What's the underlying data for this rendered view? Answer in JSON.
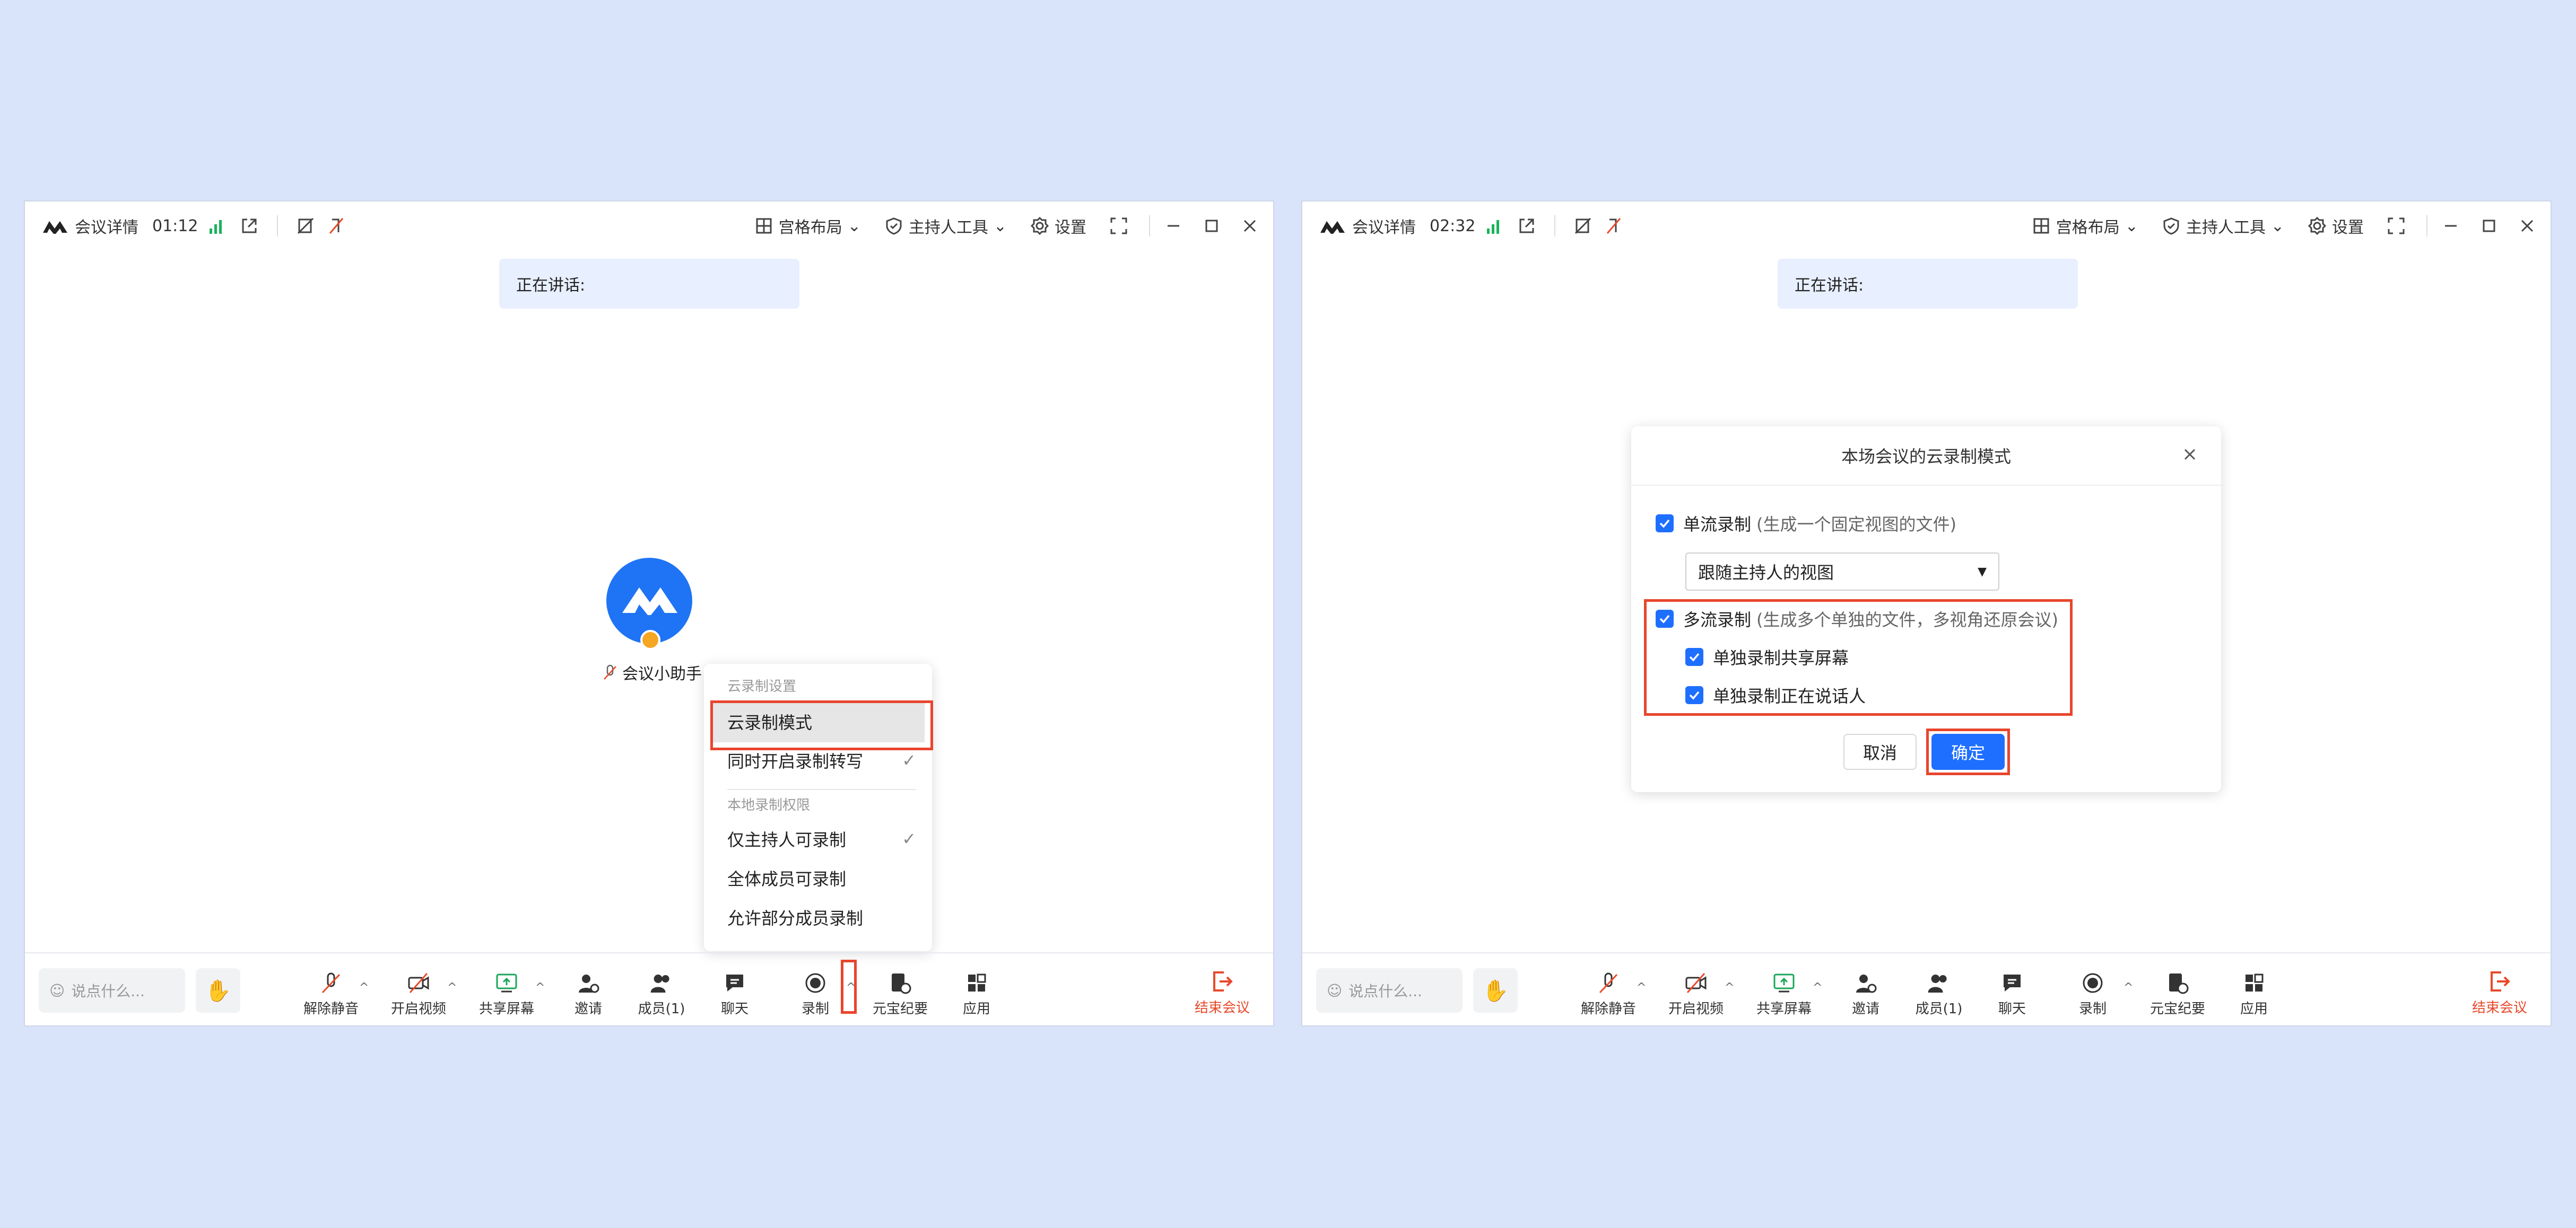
{
  "colors": {
    "background": "#d9e4fb",
    "accent": "#1e6fff",
    "danger": "#e8492b",
    "highlight_box": "#e8452d",
    "signal": "#19b35b"
  },
  "windows": [
    {
      "titlebar": {
        "meeting_details": "会议详情",
        "timer": "01:12",
        "grid_layout": "宫格布局",
        "host_tools": "主持人工具",
        "settings": "设置"
      },
      "speaking_label": "正在讲话:",
      "participant": {
        "name": "会议小助手"
      },
      "bottom": {
        "say_placeholder": "说点什么...",
        "tools": {
          "unmute": "解除静音",
          "start_video": "开启视频",
          "share_screen": "共享屏幕",
          "invite": "邀请",
          "members": "成员(1)",
          "chat": "聊天",
          "record": "录制",
          "summary": "元宝纪要",
          "apps": "应用"
        },
        "end_meeting": "结束会议"
      },
      "menu": {
        "section1": "云录制设置",
        "cloud_mode": "云录制模式",
        "transcribe": "同时开启录制转写",
        "section2": "本地录制权限",
        "host_only": "仅主持人可录制",
        "all_members": "全体成员可录制",
        "some_members": "允许部分成员录制"
      }
    },
    {
      "titlebar": {
        "meeting_details": "会议详情",
        "timer": "02:32",
        "grid_layout": "宫格布局",
        "host_tools": "主持人工具",
        "settings": "设置"
      },
      "speaking_label": "正在讲话:",
      "bottom": {
        "say_placeholder": "说点什么...",
        "tools": {
          "unmute": "解除静音",
          "start_video": "开启视频",
          "share_screen": "共享屏幕",
          "invite": "邀请",
          "members": "成员(1)",
          "chat": "聊天",
          "record": "录制",
          "summary": "元宝纪要",
          "apps": "应用"
        },
        "end_meeting": "结束会议"
      },
      "dialog": {
        "title": "本场会议的云录制模式",
        "single_stream": "单流录制",
        "single_stream_note": "(生成一个固定视图的文件)",
        "view_select": "跟随主持人的视图",
        "multi_stream": "多流录制",
        "multi_stream_note": "(生成多个单独的文件，多视角还原会议)",
        "record_share": "单独录制共享屏幕",
        "record_speaker": "单独录制正在说话人",
        "cancel": "取消",
        "confirm": "确定"
      }
    }
  ]
}
